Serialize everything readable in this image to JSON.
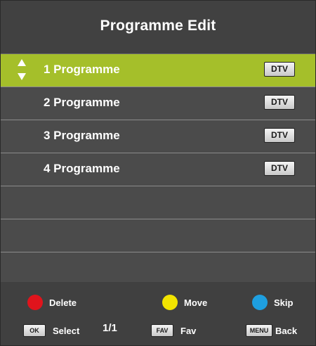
{
  "title": "Programme Edit",
  "programmes": [
    {
      "label": "1 Programme",
      "type": "DTV"
    },
    {
      "label": "2 Programme",
      "type": "DTV"
    },
    {
      "label": "3 Programme",
      "type": "DTV"
    },
    {
      "label": "4 Programme",
      "type": "DTV"
    }
  ],
  "colors": {
    "selected": "#a5bf2a",
    "red": "#e0141c",
    "yellow": "#f2e400",
    "blue": "#1e9fe0"
  },
  "footer": {
    "delete_label": "Delete",
    "move_label": "Move",
    "skip_label": "Skip",
    "ok_key": "OK",
    "select_label": "Select",
    "page": "1/1",
    "fav_key": "FAV",
    "fav_label": "Fav",
    "menu_key": "MENU",
    "back_label": "Back"
  }
}
